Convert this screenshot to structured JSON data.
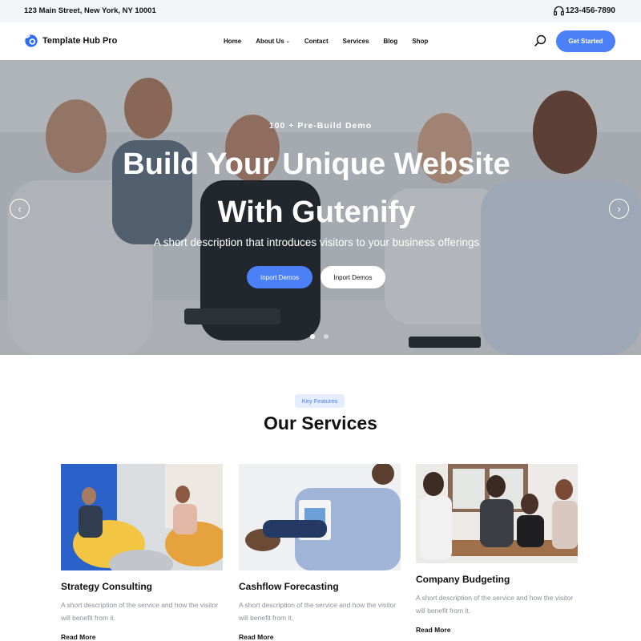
{
  "topbar": {
    "address": "123 Main Street, New York, NY 10001",
    "phone": "123-456-7890",
    "phone_icon": "headset-icon"
  },
  "header": {
    "logo_text": "Template Hub Pro",
    "nav": [
      {
        "label": "Home"
      },
      {
        "label": "About Us",
        "has_dropdown": true
      },
      {
        "label": "Contact"
      },
      {
        "label": "Services"
      },
      {
        "label": "Blog"
      },
      {
        "label": "Shop"
      }
    ],
    "cta_label": "Get Started"
  },
  "hero": {
    "eyebrow": "100 + Pre-Build Demo",
    "title_line1": "Build Your Unique Website",
    "title_line2": "With Gutenify",
    "description": "A short description that introduces visitors to your business offerings",
    "primary_button": "Inport Demos",
    "secondary_button": "Inport Demos",
    "slides": 2,
    "active_slide": 1
  },
  "services": {
    "badge": "Key Features",
    "title": "Our Services",
    "cards": [
      {
        "name": "Strategy Consulting",
        "text": "A short description of the service and how the visitor will benefit from it.",
        "link": "Read More"
      },
      {
        "name": "Cashflow Forecasting",
        "text": "A short description of the service and how the visitor will benefit from it.",
        "link": "Read More"
      },
      {
        "name": "Company Budgeting",
        "text": "A short description of the service and how the visitor will benefit from it.",
        "link": "Read More"
      }
    ]
  },
  "colors": {
    "accent": "#4b80f7",
    "topbar_bg": "#f3f5f9",
    "muted_text": "#8a8f98"
  }
}
